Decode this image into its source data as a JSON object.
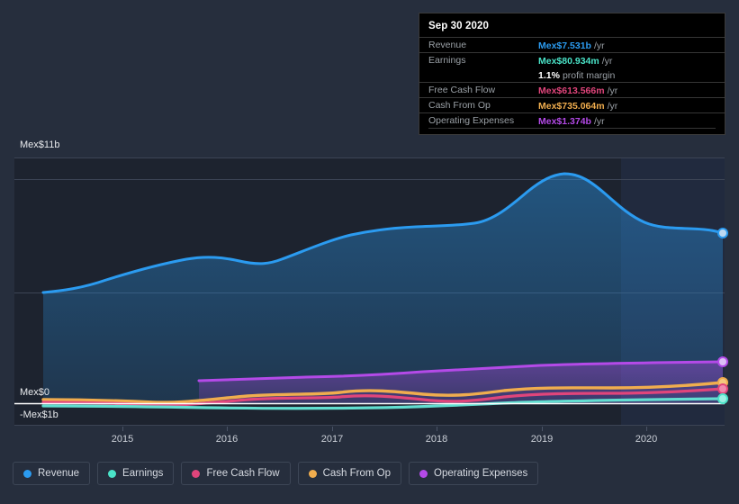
{
  "theme": {
    "page_bg": "#262e3d",
    "plot_bg": "#1d232f",
    "forecast_bg": "#1a2435",
    "grid": "#3c4455",
    "zero_line": "#ffffff"
  },
  "tooltip": {
    "date": "Sep 30 2020",
    "rows": [
      {
        "label": "Revenue",
        "value": "Mex$7.531b",
        "unit": "/yr",
        "color": "#2b9bf0"
      },
      {
        "label": "Earnings",
        "value": "Mex$80.934m",
        "unit": "/yr",
        "color": "#4ae3c8"
      },
      {
        "label": "",
        "value": "1.1%",
        "unit": "profit margin",
        "color": "#ffffff"
      },
      {
        "label": "Free Cash Flow",
        "value": "Mex$613.566m",
        "unit": "/yr",
        "color": "#e0457b"
      },
      {
        "label": "Cash From Op",
        "value": "Mex$735.064m",
        "unit": "/yr",
        "color": "#f0ad4e"
      },
      {
        "label": "Operating Expenses",
        "value": "Mex$1.374b",
        "unit": "/yr",
        "color": "#b44ae8"
      }
    ]
  },
  "axes": {
    "y_top_label": "Mex$11b",
    "y_zero_label": "Mex$0",
    "y_bottom_label": "-Mex$1b",
    "x_ticks": [
      "2015",
      "2016",
      "2017",
      "2018",
      "2019",
      "2020"
    ]
  },
  "legend": [
    {
      "label": "Revenue",
      "color": "#2b9bf0"
    },
    {
      "label": "Earnings",
      "color": "#4ae3c8"
    },
    {
      "label": "Free Cash Flow",
      "color": "#e0457b"
    },
    {
      "label": "Cash From Op",
      "color": "#f0ad4e"
    },
    {
      "label": "Operating Expenses",
      "color": "#b44ae8"
    }
  ],
  "chart_data": {
    "type": "area",
    "title": "",
    "xlabel": "",
    "ylabel": "",
    "currency": "MXN",
    "ylim": [
      -1,
      11
    ],
    "ytick_values": [
      11,
      0,
      -1
    ],
    "ytick_labels": [
      "Mex$11b",
      "Mex$0",
      "-Mex$1b"
    ],
    "xlim": [
      "2014-06",
      "2020-09"
    ],
    "x_tick_labels": [
      "2015",
      "2016",
      "2017",
      "2018",
      "2019",
      "2020"
    ],
    "grid": true,
    "legend_position": "bottom",
    "forecast_band_start": "2019-09",
    "highlight_point": "Sep 30 2020",
    "series": [
      {
        "name": "Revenue",
        "color": "#2b9bf0",
        "filled": true,
        "end_value_label": "Mex$7.531b",
        "x": [
          "2014-06",
          "2014-09",
          "2014-12",
          "2015-03",
          "2015-06",
          "2015-09",
          "2015-12",
          "2016-03",
          "2016-06",
          "2016-09",
          "2016-12",
          "2017-03",
          "2017-06",
          "2017-09",
          "2017-12",
          "2018-03",
          "2018-06",
          "2018-09",
          "2018-12",
          "2019-03",
          "2019-06",
          "2019-09",
          "2019-12",
          "2020-03",
          "2020-06",
          "2020-09"
        ],
        "values": [
          4.5,
          4.52,
          4.6,
          4.8,
          5.0,
          5.25,
          5.45,
          5.4,
          5.35,
          5.45,
          5.65,
          5.95,
          6.25,
          6.3,
          6.3,
          6.35,
          6.45,
          6.85,
          7.6,
          8.45,
          8.9,
          8.7,
          8.2,
          7.95,
          7.75,
          7.531
        ]
      },
      {
        "name": "Earnings",
        "color": "#4ae3c8",
        "filled": true,
        "end_value_label": "Mex$80.934m",
        "x": [
          "2014-06",
          "2015-00",
          "2015-06",
          "2016-00",
          "2016-06",
          "2017-00",
          "2017-06",
          "2018-00",
          "2018-06",
          "2019-00",
          "2019-06",
          "2020-00",
          "2020-09"
        ],
        "values": [
          -0.3,
          -0.28,
          -0.26,
          -0.24,
          -0.22,
          -0.2,
          -0.18,
          -0.15,
          -0.1,
          -0.05,
          0.02,
          0.06,
          0.081
        ]
      },
      {
        "name": "Free Cash Flow",
        "color": "#e0457b",
        "filled": true,
        "end_value_label": "Mex$613.566m",
        "x": [
          "2014-06",
          "2015-00",
          "2015-06",
          "2016-00",
          "2016-06",
          "2017-00",
          "2017-06",
          "2018-00",
          "2018-06",
          "2019-00",
          "2019-06",
          "2020-00",
          "2020-09"
        ],
        "values": [
          0.1,
          0.08,
          0.05,
          0.08,
          0.22,
          0.18,
          0.05,
          0.15,
          0.32,
          0.45,
          0.5,
          0.55,
          0.614
        ]
      },
      {
        "name": "Cash From Op",
        "color": "#f0ad4e",
        "filled": true,
        "end_value_label": "Mex$735.064m",
        "x": [
          "2014-06",
          "2015-00",
          "2015-06",
          "2016-00",
          "2016-06",
          "2017-00",
          "2017-06",
          "2018-00",
          "2018-06",
          "2019-00",
          "2019-06",
          "2020-00",
          "2020-09"
        ],
        "values": [
          0.22,
          0.2,
          0.14,
          0.2,
          0.32,
          0.28,
          0.22,
          0.35,
          0.52,
          0.62,
          0.64,
          0.66,
          0.735
        ]
      },
      {
        "name": "Operating Expenses",
        "color": "#b44ae8",
        "filled": true,
        "start_x": "2015-09",
        "end_value_label": "Mex$1.374b",
        "x": [
          "2015-09",
          "2016-00",
          "2016-06",
          "2017-00",
          "2017-06",
          "2018-00",
          "2018-06",
          "2019-00",
          "2019-06",
          "2020-00",
          "2020-09"
        ],
        "values": [
          1.02,
          1.04,
          1.06,
          1.08,
          1.14,
          1.2,
          1.22,
          1.3,
          1.34,
          1.35,
          1.374
        ]
      }
    ]
  }
}
